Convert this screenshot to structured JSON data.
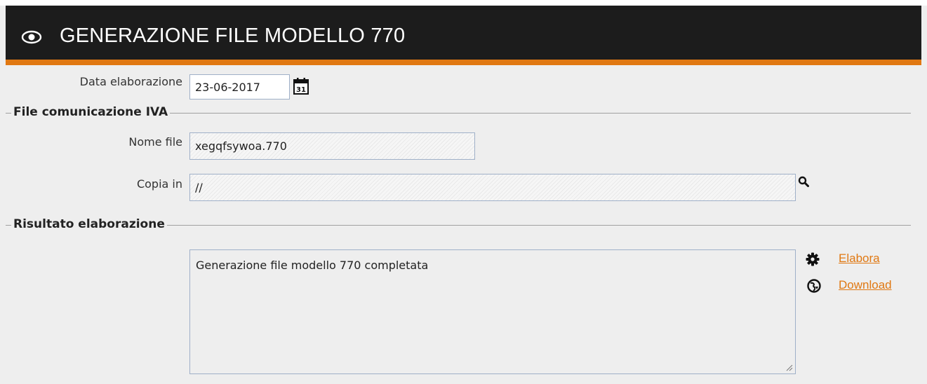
{
  "header": {
    "title": "GENERAZIONE FILE MODELLO 770",
    "icon": "eye-icon"
  },
  "colors": {
    "header_bg": "#1c1c1c",
    "accent": "#e07812",
    "link": "#e07812",
    "page_bg": "#eeeeee"
  },
  "form": {
    "data_elaborazione": {
      "label": "Data elaborazione",
      "value": "23-06-2017",
      "calendar_day": "31"
    }
  },
  "file_section": {
    "legend": "File comunicazione IVA",
    "nome_file": {
      "label": "Nome file",
      "value": "xegqfsywoa.770"
    },
    "copia_in": {
      "label": "Copia in",
      "value": "//"
    }
  },
  "result_section": {
    "legend": "Risultato elaborazione",
    "message": "Generazione file modello 770 completata",
    "actions": {
      "elabora": "Elabora",
      "download": "Download"
    }
  }
}
